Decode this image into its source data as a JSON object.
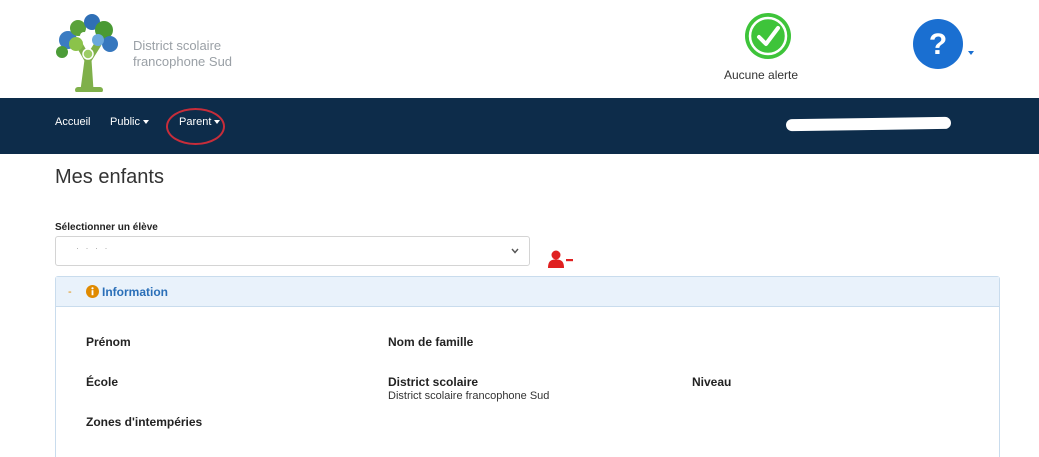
{
  "header": {
    "logo_text_line1": "District scolaire",
    "logo_text_line2": "francophone Sud",
    "alert_text": "Aucune alerte"
  },
  "navbar": {
    "items": [
      {
        "label": "Accueil"
      },
      {
        "label": "Public"
      },
      {
        "label": "Parent"
      }
    ]
  },
  "main": {
    "title": "Mes enfants",
    "select_label": "Sélectionner un élève",
    "select_value": "· · · ·"
  },
  "panel": {
    "title": "Information",
    "fields": {
      "first_name_label": "Prénom",
      "last_name_label": "Nom de famille",
      "school_label": "École",
      "district_label": "District scolaire",
      "district_value": "District scolaire francophone Sud",
      "grade_label": "Niveau",
      "weather_label": "Zones d'intempéries"
    }
  },
  "colors": {
    "navbar": "#0d2c4a",
    "alert_ok": "#3ec43a",
    "help": "#1a6fd1",
    "remove_user": "#e02020",
    "panel_header": "#e9f2fb",
    "panel_title": "#2a6fb8",
    "highlight_circle": "#c72d3a"
  },
  "icons": {
    "logo": "tree-logo-icon",
    "alert": "check-circle-icon",
    "help": "question-circle-icon",
    "remove_user": "user-minus-icon",
    "info": "info-circle-icon"
  }
}
